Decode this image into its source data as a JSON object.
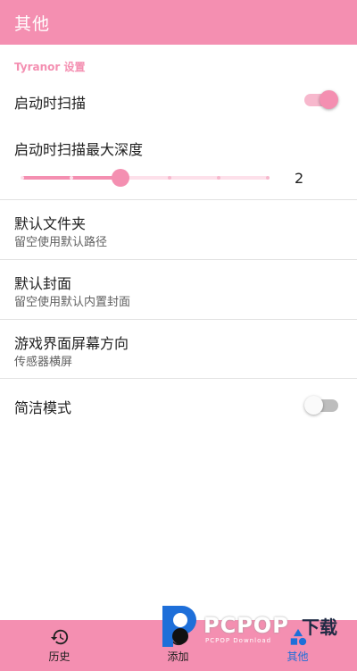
{
  "appbar": {
    "title": "其他"
  },
  "section": {
    "header": "Tyranor 设置"
  },
  "settings": {
    "scan_on_start": {
      "title": "启动时扫描",
      "on": true
    },
    "max_depth": {
      "title": "启动时扫描最大深度",
      "value": "2",
      "min": 0,
      "max": 5,
      "current": 2
    },
    "default_folder": {
      "title": "默认文件夹",
      "subtitle": "留空使用默认路径"
    },
    "default_cover": {
      "title": "默认封面",
      "subtitle": "留空使用默认内置封面"
    },
    "orientation": {
      "title": "游戏界面屏幕方向",
      "subtitle": "传感器横屏"
    },
    "simple_mode": {
      "title": "简洁模式",
      "on": false
    }
  },
  "bottom_nav": {
    "items": [
      {
        "label": "历史",
        "icon": "history-icon"
      },
      {
        "label": "添加",
        "icon": "add-icon"
      },
      {
        "label": "其他",
        "icon": "shapes-icon"
      }
    ],
    "active_index": 2
  },
  "watermark": {
    "word": "PCPOP",
    "cn": "下载",
    "sub": "PCPOP Download"
  },
  "colors": {
    "accent": "#f48fb1",
    "accent_light": "#f7b8cd",
    "active_nav": "#1e6fd9",
    "watermark_blue": "#1e6fd9"
  }
}
